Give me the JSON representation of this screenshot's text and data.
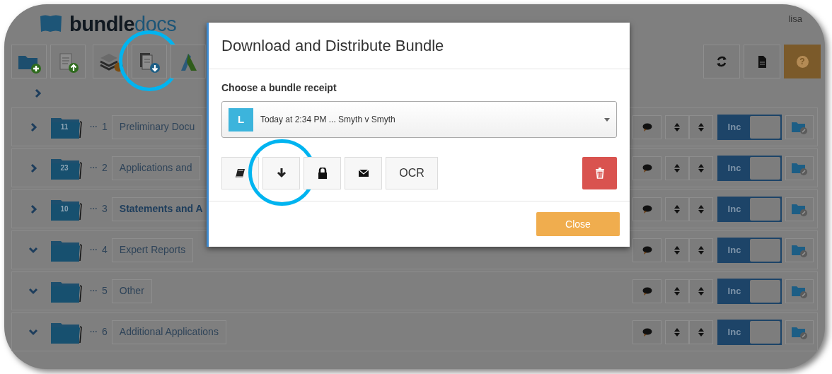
{
  "header": {
    "logo": {
      "part_1": "bundle",
      "part_2": "docs"
    },
    "user": "lisa"
  },
  "toolbar": {
    "left_buttons": [
      {
        "kind": "new-folder",
        "circled": false
      },
      {
        "kind": "upload",
        "circled": false
      },
      {
        "kind": "layers",
        "circled": false
      },
      {
        "kind": "download-documents",
        "circled": true
      },
      {
        "kind": "mark",
        "circled": false
      }
    ],
    "right_buttons": [
      {
        "kind": "refresh"
      },
      {
        "kind": "document"
      },
      {
        "kind": "help",
        "label": "?"
      }
    ]
  },
  "breadcrumb": {
    "expanded": false
  },
  "sections": [
    {
      "expanded": false,
      "count": "11",
      "dots": "···",
      "number": "1",
      "title": "Preliminary Docu",
      "highlighted": false,
      "included": true,
      "toggle_label": "Inc"
    },
    {
      "expanded": false,
      "count": "23",
      "dots": "···",
      "number": "2",
      "title": "Applications and",
      "highlighted": false,
      "included": true,
      "toggle_label": "Inc"
    },
    {
      "expanded": false,
      "count": "10",
      "dots": "···",
      "number": "3",
      "title": "Statements and A",
      "highlighted": true,
      "included": true,
      "toggle_label": "Inc"
    },
    {
      "expanded": true,
      "dots": "···",
      "number": "4",
      "title": "Expert Reports",
      "highlighted": false,
      "included": true,
      "toggle_label": "Inc"
    },
    {
      "expanded": true,
      "dots": "···",
      "number": "5",
      "title": "Other",
      "highlighted": false,
      "included": true,
      "toggle_label": "Inc"
    },
    {
      "expanded": true,
      "dots": "···",
      "number": "6",
      "title": "Additional Applications",
      "highlighted": false,
      "included": true,
      "toggle_label": "Inc"
    }
  ],
  "modal": {
    "title": "Download and Distribute Bundle",
    "label": "Choose a bundle receipt",
    "select": {
      "avatar": "L",
      "value": "Today at 2:34 PM ... Smyth v Smyth"
    },
    "actions": [
      {
        "kind": "book",
        "circled": false
      },
      {
        "kind": "download",
        "circled": true
      },
      {
        "kind": "lock",
        "circled": false
      },
      {
        "kind": "email",
        "circled": false
      },
      {
        "kind": "text",
        "label": "OCR",
        "circled": false
      }
    ],
    "delete": {
      "kind": "trash"
    },
    "close_button": "Close"
  }
}
